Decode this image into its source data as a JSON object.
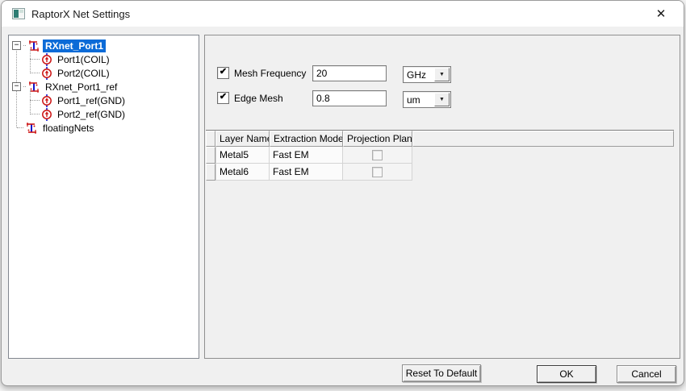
{
  "window": {
    "title": "RaptorX Net Settings"
  },
  "icons": {
    "collapse": "−",
    "dropdown": "▼",
    "check": "✔",
    "close": "✕"
  },
  "colors": {
    "selection": "#0c6bd7",
    "net_blue": "#1414cc",
    "port_red": "#cc1414"
  },
  "tree": {
    "items": [
      {
        "label": "RXnet_Port1",
        "type": "net",
        "selected": true,
        "expanded": true
      },
      {
        "label": "Port1(COIL)",
        "type": "port"
      },
      {
        "label": "Port2(COIL)",
        "type": "port"
      },
      {
        "label": "RXnet_Port1_ref",
        "type": "net",
        "expanded": true
      },
      {
        "label": "Port1_ref(GND)",
        "type": "port"
      },
      {
        "label": "Port2_ref(GND)",
        "type": "port"
      },
      {
        "label": "floatingNets",
        "type": "net"
      }
    ]
  },
  "settings": {
    "mesh_frequency": {
      "label": "Mesh Frequency",
      "checked": true,
      "value": "20",
      "unit": "GHz"
    },
    "edge_mesh": {
      "label": "Edge Mesh",
      "checked": true,
      "value": "0.8",
      "unit": "um"
    }
  },
  "layer_table": {
    "columns": [
      "Layer Name",
      "Extraction Mode",
      "Projection Plane"
    ],
    "rows": [
      {
        "layer": "Metal5",
        "mode": "Fast EM",
        "projection_checked": false
      },
      {
        "layer": "Metal6",
        "mode": "Fast EM",
        "projection_checked": false
      }
    ]
  },
  "buttons": {
    "reset": "Reset To Default",
    "ok": "OK",
    "cancel": "Cancel"
  }
}
